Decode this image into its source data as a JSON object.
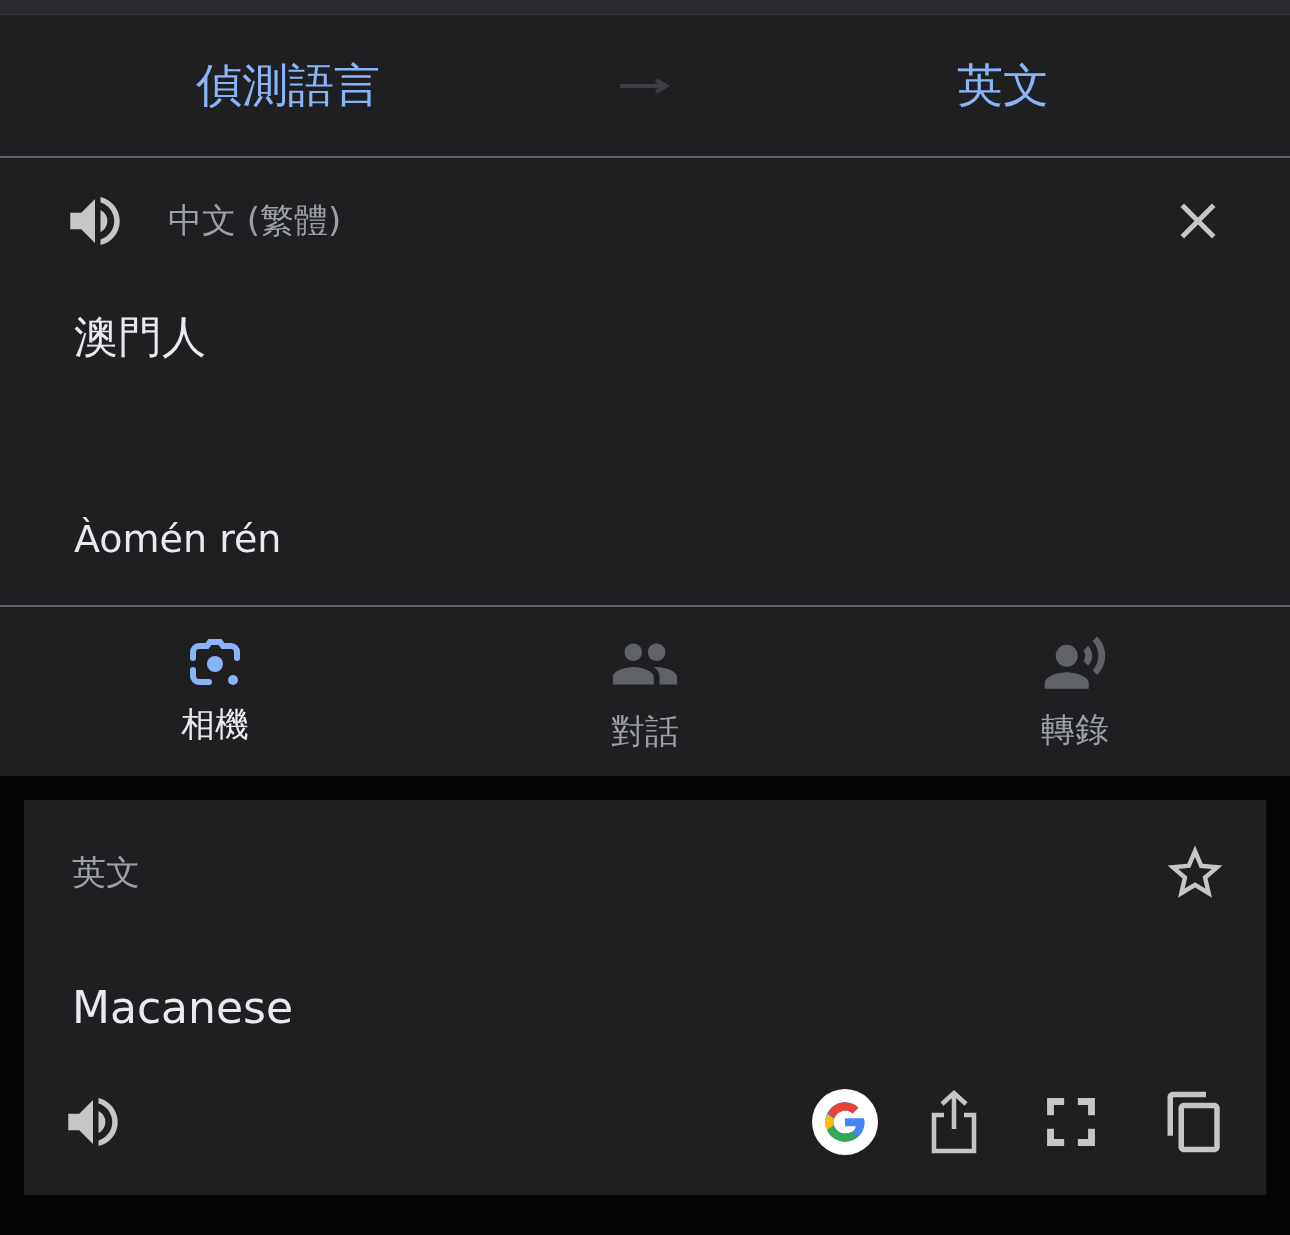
{
  "language_bar": {
    "source": "偵測語言",
    "target": "英文"
  },
  "input": {
    "language": "中文 (繁體)",
    "text": "澳門人",
    "romanization": "Àomén rén"
  },
  "modes": [
    {
      "kind": "camera",
      "label": "相機",
      "selected": true
    },
    {
      "kind": "conversation",
      "label": "對話",
      "selected": false
    },
    {
      "kind": "transcribe",
      "label": "轉錄",
      "selected": false
    }
  ],
  "result": {
    "language": "英文",
    "text": "Macanese",
    "starred": false
  }
}
